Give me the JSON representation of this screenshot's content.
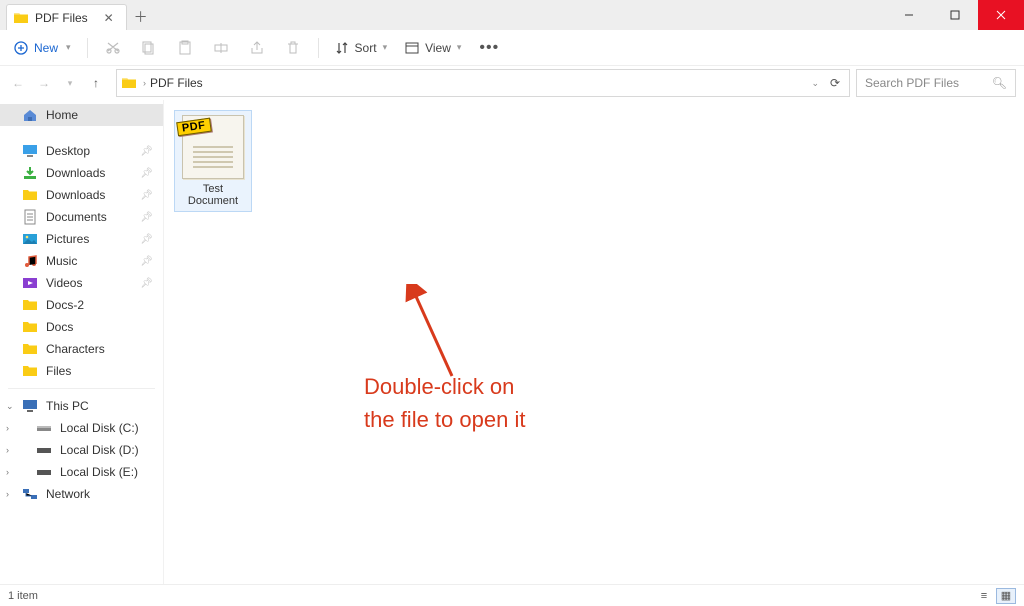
{
  "window": {
    "tab_title": "PDF Files"
  },
  "toolbar": {
    "new": "New",
    "sort": "Sort",
    "view": "View"
  },
  "breadcrumb": {
    "segments": [
      "PDF Files"
    ]
  },
  "search": {
    "placeholder": "Search PDF Files"
  },
  "sidebar": {
    "home": "Home",
    "quick": [
      {
        "label": "Desktop"
      },
      {
        "label": "Downloads"
      },
      {
        "label": "Downloads"
      },
      {
        "label": "Documents"
      },
      {
        "label": "Pictures"
      },
      {
        "label": "Music"
      },
      {
        "label": "Videos"
      },
      {
        "label": "Docs-2"
      },
      {
        "label": "Docs"
      },
      {
        "label": "Characters"
      },
      {
        "label": "Files"
      }
    ],
    "thispc": "This PC",
    "drives": [
      {
        "label": "Local Disk (C:)"
      },
      {
        "label": "Local Disk (D:)"
      },
      {
        "label": "Local Disk (E:)"
      }
    ],
    "network": "Network"
  },
  "files": [
    {
      "name": "Test Document",
      "badge": "PDF"
    }
  ],
  "annotation": {
    "line1": "Double-click on",
    "line2": "the file to open it"
  },
  "status": {
    "text": "1 item"
  },
  "colors": {
    "accent": "#1a66d1",
    "close": "#e81123",
    "annotation": "#d83a1c"
  }
}
